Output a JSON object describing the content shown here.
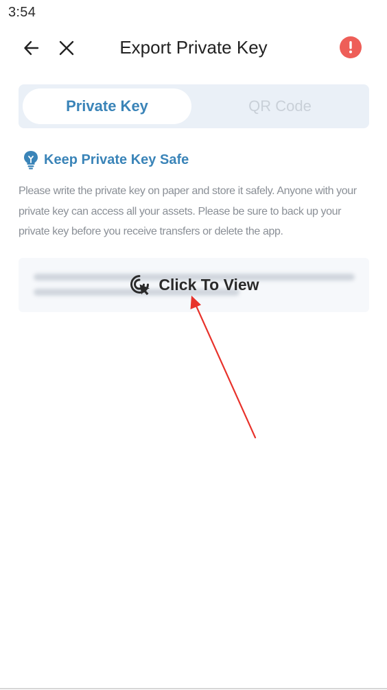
{
  "status_bar": {
    "time": "3:54"
  },
  "header": {
    "title": "Export Private Key",
    "back_icon": "arrow-left-icon",
    "close_icon": "close-icon",
    "alert_icon": "exclamation-icon"
  },
  "tabs": [
    {
      "label": "Private Key",
      "active": true
    },
    {
      "label": "QR Code",
      "active": false
    }
  ],
  "tip": {
    "icon": "lightbulb-icon",
    "title": "Keep Private Key Safe",
    "description": "Please write the private key on paper and store it safely. Anyone with your private key can access all your assets. Please be sure to back up your private key before you receive transfers or delete the app."
  },
  "key_box": {
    "label": "Click To View",
    "icon": "cursor-click-icon"
  },
  "colors": {
    "accent": "#3a84b8",
    "alert": "#ee5e58",
    "annotation_arrow": "#e8322b"
  }
}
